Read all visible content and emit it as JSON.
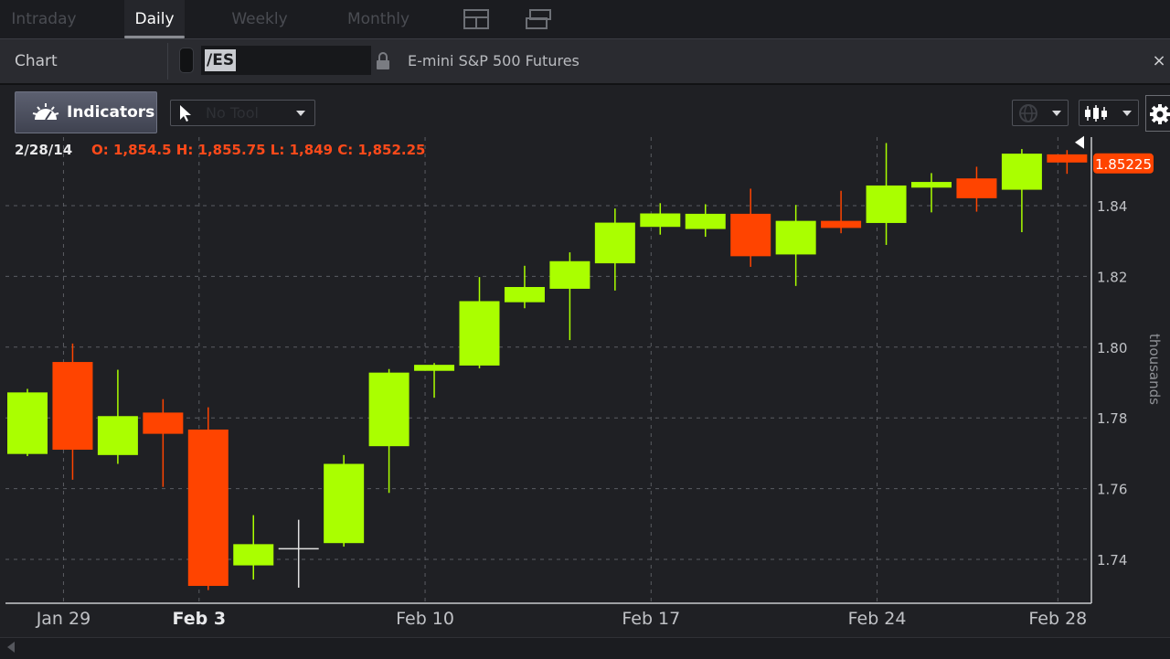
{
  "tabs": [
    {
      "label": "Intraday",
      "active": false
    },
    {
      "label": "Daily",
      "active": true
    },
    {
      "label": "Weekly",
      "active": false
    },
    {
      "label": "Monthly",
      "active": false
    }
  ],
  "header": {
    "chart_label": "Chart",
    "symbol": "/ES",
    "description": "E-mini S&P 500 Futures",
    "close_glyph": "×"
  },
  "toolbar": {
    "indicators_label": "Indicators",
    "tool_placeholder": "No Tool"
  },
  "readout": {
    "date": "2/28/14",
    "ohlc": "O: 1,854.5  H: 1,855.75  L: 1,849  C: 1,852.25"
  },
  "colors": {
    "up": "#aaff00",
    "down": "#ff4400",
    "background": "#1f2024",
    "grid": "#5a5c62"
  },
  "chart_data": {
    "type": "candlestick",
    "ylabel": "thousands",
    "ylim": [
      1.73,
      1.862
    ],
    "yticks": [
      "1.74",
      "1.76",
      "1.78",
      "1.80",
      "1.82",
      "1.84"
    ],
    "ytick_values": [
      1.74,
      1.76,
      1.78,
      1.8,
      1.82,
      1.84
    ],
    "xticks": [
      {
        "label": "Jan 29",
        "index": 1,
        "bold": false
      },
      {
        "label": "Feb 3",
        "index": 4,
        "bold": true
      },
      {
        "label": "Feb 10",
        "index": 9,
        "bold": false
      },
      {
        "label": "Feb 17",
        "index": 14,
        "bold": false
      },
      {
        "label": "Feb 24",
        "index": 19,
        "bold": false
      },
      {
        "label": "Feb 28",
        "index": 23,
        "bold": false
      }
    ],
    "last_price_label": "1.85225",
    "candles": [
      {
        "o": 1.7698,
        "h": 1.7882,
        "l": 1.7692,
        "c": 1.7872
      },
      {
        "o": 1.7958,
        "h": 1.801,
        "l": 1.7625,
        "c": 1.771
      },
      {
        "o": 1.7695,
        "h": 1.7936,
        "l": 1.767,
        "c": 1.7805
      },
      {
        "o": 1.7815,
        "h": 1.7853,
        "l": 1.7605,
        "c": 1.7755
      },
      {
        "o": 1.7767,
        "h": 1.783,
        "l": 1.7313,
        "c": 1.7325
      },
      {
        "o": 1.7383,
        "h": 1.7525,
        "l": 1.7343,
        "c": 1.7443
      },
      {
        "o": 1.743,
        "h": 1.7512,
        "l": 1.732,
        "c": 1.743,
        "neutral": true
      },
      {
        "o": 1.7446,
        "h": 1.7695,
        "l": 1.7436,
        "c": 1.767
      },
      {
        "o": 1.772,
        "h": 1.7938,
        "l": 1.7588,
        "c": 1.7928
      },
      {
        "o": 1.7933,
        "h": 1.7955,
        "l": 1.7857,
        "c": 1.795
      },
      {
        "o": 1.7948,
        "h": 1.8198,
        "l": 1.794,
        "c": 1.813
      },
      {
        "o": 1.8127,
        "h": 1.823,
        "l": 1.811,
        "c": 1.817
      },
      {
        "o": 1.8165,
        "h": 1.8268,
        "l": 1.802,
        "c": 1.8243
      },
      {
        "o": 1.8237,
        "h": 1.8392,
        "l": 1.816,
        "c": 1.8352
      },
      {
        "o": 1.834,
        "h": 1.8407,
        "l": 1.8318,
        "c": 1.8378
      },
      {
        "o": 1.8334,
        "h": 1.8404,
        "l": 1.8312,
        "c": 1.8377
      },
      {
        "o": 1.8377,
        "h": 1.8448,
        "l": 1.8227,
        "c": 1.8257
      },
      {
        "o": 1.8262,
        "h": 1.8402,
        "l": 1.8173,
        "c": 1.8357
      },
      {
        "o": 1.8357,
        "h": 1.8442,
        "l": 1.8322,
        "c": 1.8337
      },
      {
        "o": 1.8351,
        "h": 1.8577,
        "l": 1.8289,
        "c": 1.8457
      },
      {
        "o": 1.8451,
        "h": 1.8492,
        "l": 1.8381,
        "c": 1.8467
      },
      {
        "o": 1.8477,
        "h": 1.851,
        "l": 1.8383,
        "c": 1.8421
      },
      {
        "o": 1.8445,
        "h": 1.856,
        "l": 1.8325,
        "c": 1.8547
      },
      {
        "o": 1.8545,
        "h": 1.8557,
        "l": 1.849,
        "c": 1.8522
      }
    ]
  }
}
